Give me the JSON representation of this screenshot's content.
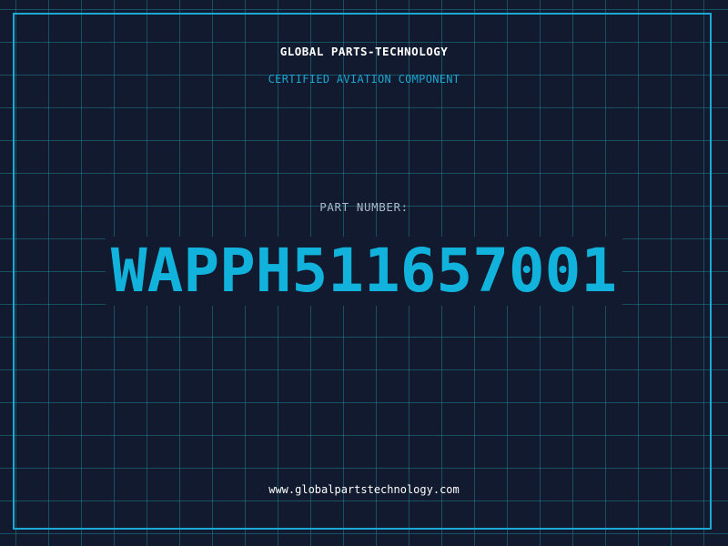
{
  "header": {
    "brand": "GLOBAL PARTS-TECHNOLOGY",
    "subtitle": "CERTIFIED AVIATION COMPONENT"
  },
  "part": {
    "label": "PART NUMBER:",
    "number": "WAPPH511657001"
  },
  "footer": {
    "url": "www.globalpartstechnology.com"
  },
  "colors": {
    "background": "#111a2e",
    "grid": "#1f7c8a",
    "frame": "#1aa8d4",
    "accent": "#11b3dd",
    "label": "#a9b8c8",
    "text": "#ffffff"
  }
}
